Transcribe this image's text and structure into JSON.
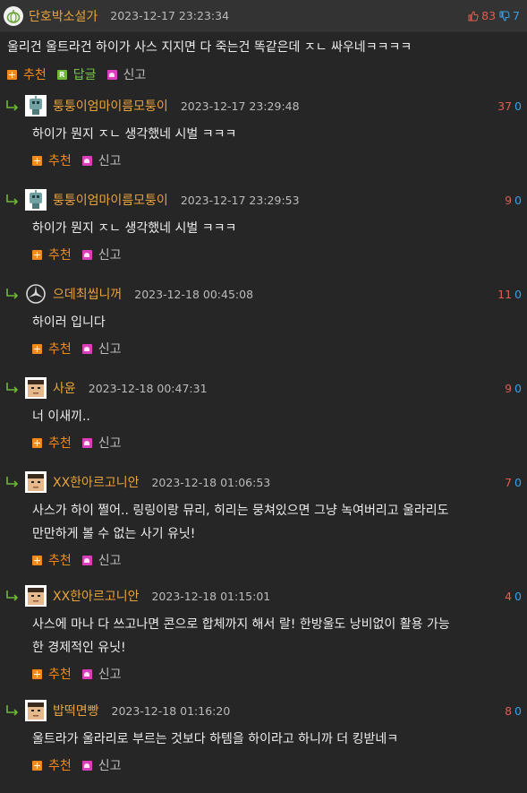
{
  "post": {
    "nick": "단호박소설가",
    "date": "2023-12-17 23:23:34",
    "up": "83",
    "down": "7",
    "text": "울리건 울트라건 하이가 사스 지지면 다 죽는건 똑같은데 ㅈㄴ 싸우네ㅋㅋㅋㅋ",
    "recommend": "추천",
    "reply": "답글",
    "report": "신고"
  },
  "colors": {
    "background": "#262626",
    "topbar": "#333333",
    "nick": "#e8a33c",
    "up": "#e05c4f",
    "down": "#3d9fe0",
    "recommend": "#f08a1c",
    "reply": "#79c44a",
    "report_icon": "#d93fbd"
  },
  "replies": [
    {
      "nick": "퉁퉁이엄마이름모퉁이",
      "date": "2023-12-17 23:29:48",
      "up": "37",
      "down": "0",
      "text": [
        "하이가 뭔지 ㅈㄴ 생각했네 시벌 ㅋㅋㅋ"
      ],
      "avatar": "robot-avatar-icon",
      "recommend": "추천",
      "report": "신고"
    },
    {
      "nick": "퉁퉁이엄마이름모퉁이",
      "date": "2023-12-17 23:29:53",
      "up": "9",
      "down": "0",
      "text": [
        "하이가 뭔지 ㅈㄴ 생각했네 시벌 ㅋㅋㅋ"
      ],
      "avatar": "robot-avatar-icon",
      "recommend": "추천",
      "report": "신고"
    },
    {
      "nick": "으데최씹니꺼",
      "date": "2023-12-18 00:45:08",
      "up": "11",
      "down": "0",
      "text": [
        "하이러 입니다"
      ],
      "avatar": "star-logo-avatar-icon",
      "recommend": "추천",
      "report": "신고"
    },
    {
      "nick": "사윤",
      "date": "2023-12-18 00:47:31",
      "up": "9",
      "down": "0",
      "text": [
        "너 이새끼.."
      ],
      "avatar": "pixel-face-avatar-icon",
      "recommend": "추천",
      "report": "신고"
    },
    {
      "nick": "XX한아르고니안",
      "date": "2023-12-18 01:06:53",
      "up": "7",
      "down": "0",
      "text": [
        "사스가 하이 쩔어.. 링링이랑 뮤리, 히리는 뭉쳐있으면 그냥 녹여버리고 울라리도",
        "만만하게 볼 수 없는 사기 유닛!"
      ],
      "avatar": "pixel-face-avatar-icon",
      "recommend": "추천",
      "report": "신고"
    },
    {
      "nick": "XX한아르고니안",
      "date": "2023-12-18 01:15:01",
      "up": "4",
      "down": "0",
      "text": [
        "사스에 마나 다 쓰고나면 콘으로 합체까지 해서 랄! 한방울도 낭비없이 활용 가능",
        "한 경제적인 유닛!"
      ],
      "avatar": "pixel-face-avatar-icon",
      "recommend": "추천",
      "report": "신고"
    },
    {
      "nick": "밥떡면빵",
      "date": "2023-12-18 01:16:20",
      "up": "8",
      "down": "0",
      "text": [
        "울트라가 울라리로 부르는 것보다 하템을 하이라고 하니까 더 킹받네ㅋ"
      ],
      "avatar": "pixel-face-avatar-icon",
      "recommend": "추천",
      "report": "신고"
    }
  ]
}
